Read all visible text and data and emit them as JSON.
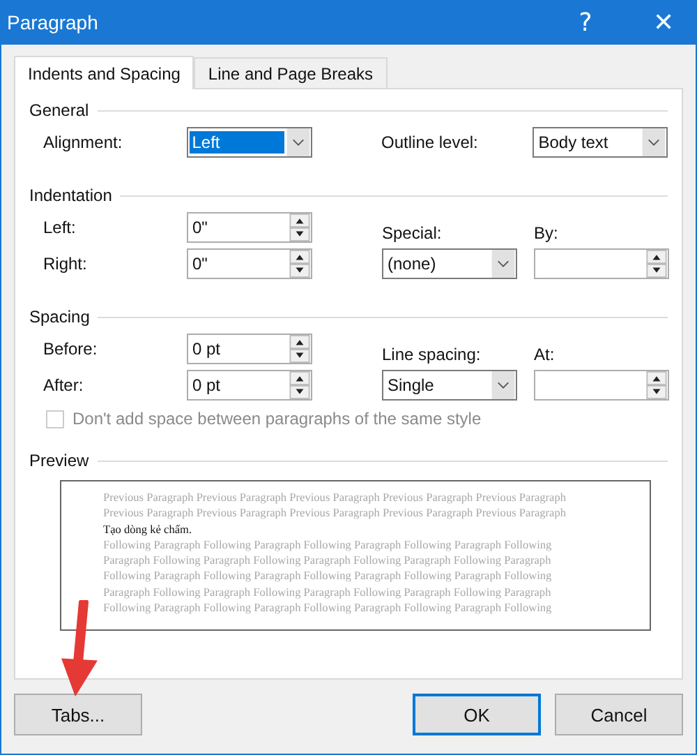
{
  "window": {
    "title": "Paragraph",
    "help_glyph": "?",
    "close_glyph": "✕"
  },
  "tabs": [
    {
      "label": "Indents and Spacing",
      "selected": true
    },
    {
      "label": "Line and Page Breaks",
      "selected": false
    }
  ],
  "general": {
    "heading": "General",
    "alignment": {
      "label": "Alignment:",
      "value": "Left",
      "highlighted": true
    },
    "outline_level": {
      "label": "Outline level:",
      "value": "Body text",
      "highlighted": false
    }
  },
  "indentation": {
    "heading": "Indentation",
    "left": {
      "label": "Left:",
      "value": "0\""
    },
    "right": {
      "label": "Right:",
      "value": "0\""
    },
    "special": {
      "label": "Special:",
      "value": "(none)",
      "highlighted": false
    },
    "by": {
      "label": "By:"
    }
  },
  "spacing": {
    "heading": "Spacing",
    "before": {
      "label": "Before:",
      "value": "0 pt"
    },
    "after": {
      "label": "After:",
      "value": "0 pt"
    },
    "line_spacing": {
      "label": "Line spacing:",
      "value": "Single",
      "highlighted": false
    },
    "at": {
      "label": "At:"
    },
    "no_space_checkbox": {
      "label": "Don't add space between paragraphs of the same style",
      "checked": false,
      "disabled": true
    }
  },
  "preview": {
    "heading": "Preview",
    "lines": [
      {
        "kind": "previous",
        "text": "Previous Paragraph Previous Paragraph Previous Paragraph Previous Paragraph Previous Paragraph"
      },
      {
        "kind": "previous",
        "text": "Previous Paragraph Previous Paragraph Previous Paragraph Previous Paragraph Previous Paragraph"
      },
      {
        "kind": "current",
        "text": "Tạo dòng kẻ chấm."
      },
      {
        "kind": "following",
        "text": "Following Paragraph Following Paragraph Following Paragraph Following Paragraph Following"
      },
      {
        "kind": "following",
        "text": "Paragraph Following Paragraph Following Paragraph Following Paragraph Following Paragraph"
      },
      {
        "kind": "following",
        "text": "Following Paragraph Following Paragraph Following Paragraph Following Paragraph Following"
      },
      {
        "kind": "following",
        "text": "Paragraph Following Paragraph Following Paragraph Following Paragraph Following Paragraph"
      },
      {
        "kind": "following",
        "text": "Following Paragraph Following Paragraph Following Paragraph Following Paragraph Following"
      }
    ]
  },
  "buttons": [
    {
      "label": "Tabs...",
      "default": false
    },
    {
      "label": "OK",
      "default": true
    },
    {
      "label": "Cancel",
      "default": false
    }
  ]
}
